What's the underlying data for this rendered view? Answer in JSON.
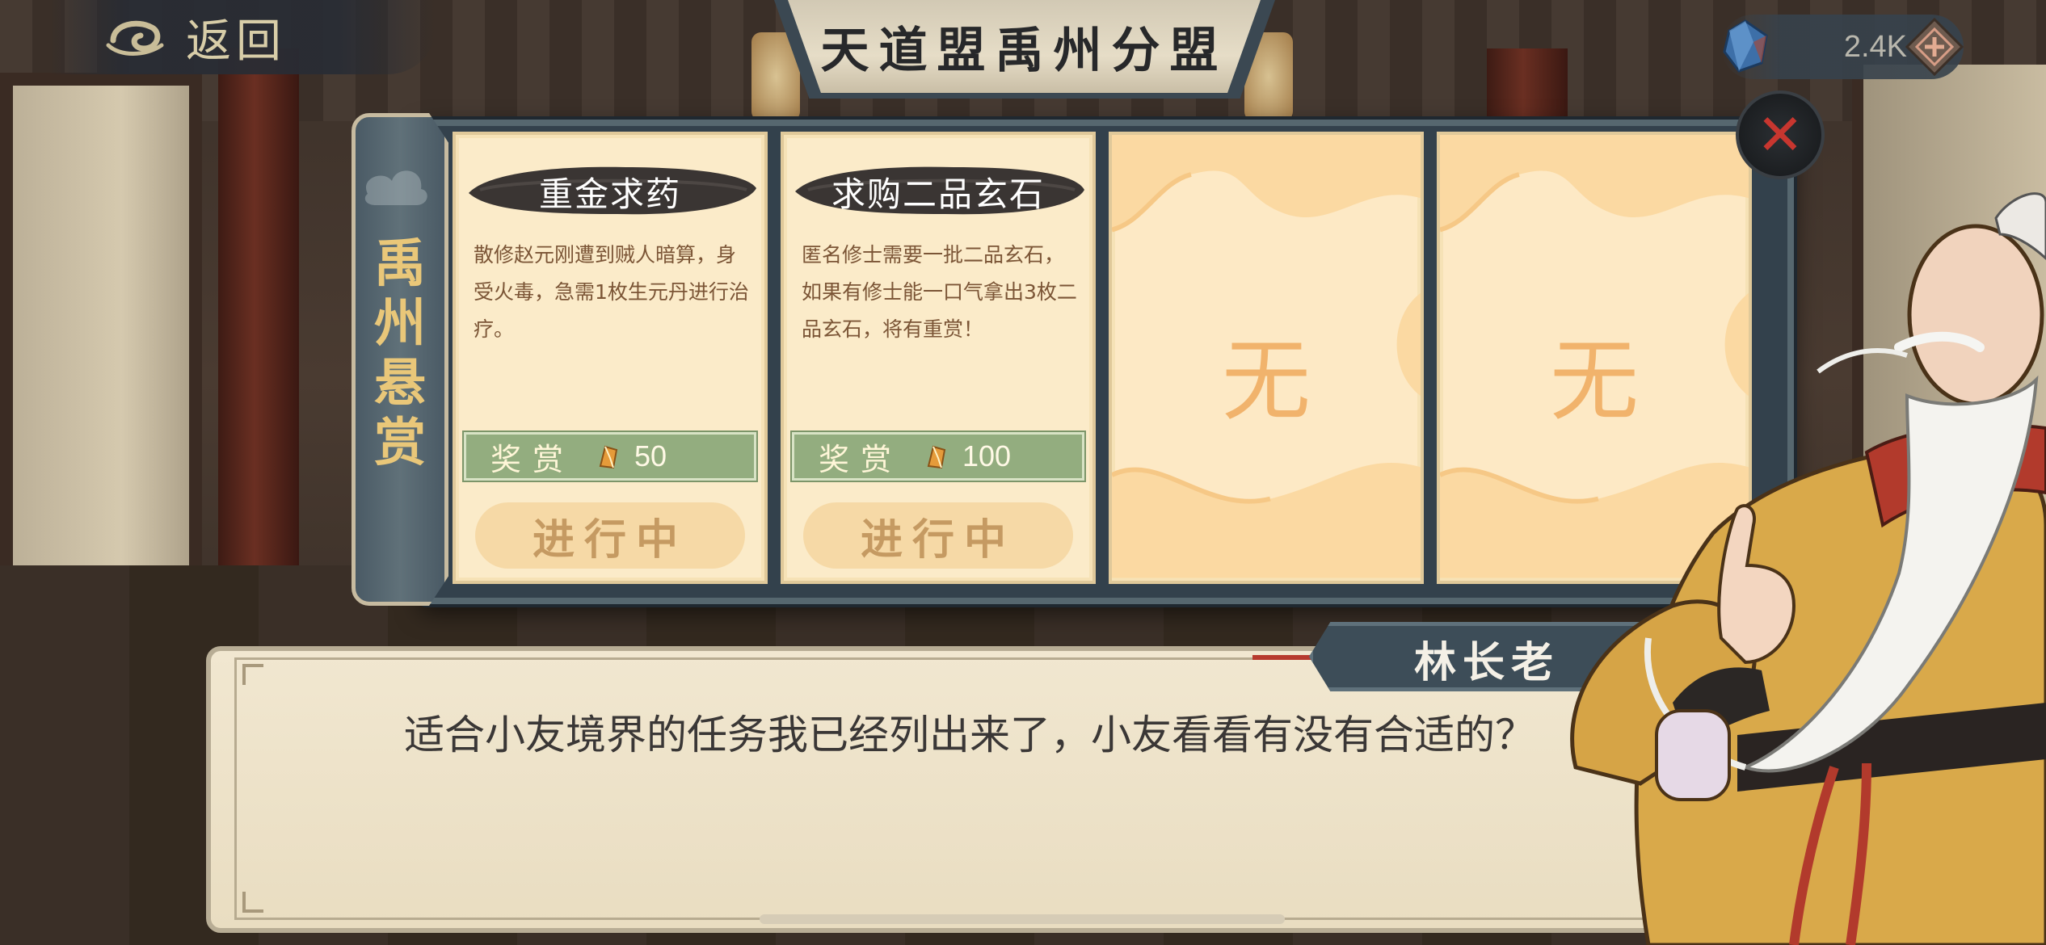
{
  "top_bar": {
    "back_label": "返回",
    "title": "天道盟禹州分盟",
    "currency_value": "2.4K"
  },
  "panel": {
    "side_title": "禹州悬赏",
    "cards": [
      {
        "title": "重金求药",
        "description": "散修赵元刚遭到贼人暗算，身受火毒，急需1枚生元丹进行治疗。",
        "reward_label": "奖赏",
        "reward_value": "50",
        "status": "进行中"
      },
      {
        "title": "求购二品玄石",
        "description": "匿名修士需要一批二品玄石，如果有修士能一口气拿出3枚二品玄石，将有重赏！",
        "reward_label": "奖赏",
        "reward_value": "100",
        "status": "进行中"
      },
      {
        "empty_glyph": "无"
      },
      {
        "empty_glyph": "无"
      }
    ]
  },
  "dialog": {
    "speaker": "林长老",
    "text": "适合小友境界的任务我已经列出来了，小友看看有没有合适的？"
  },
  "colors": {
    "panel_bg": "#33414c",
    "card_bg": "#fbebc9",
    "reward_green": "#93ad7f",
    "status_bg": "#f6d9a6",
    "side_title_gold": "#e9c779",
    "close_red": "#c8362f"
  },
  "icons": {
    "back": "cloud-swirl-icon",
    "currency": "spirit-stone-icon",
    "currency_add": "add-diamond-icon",
    "reward": "spirit-stone-icon",
    "close": "close-icon"
  }
}
